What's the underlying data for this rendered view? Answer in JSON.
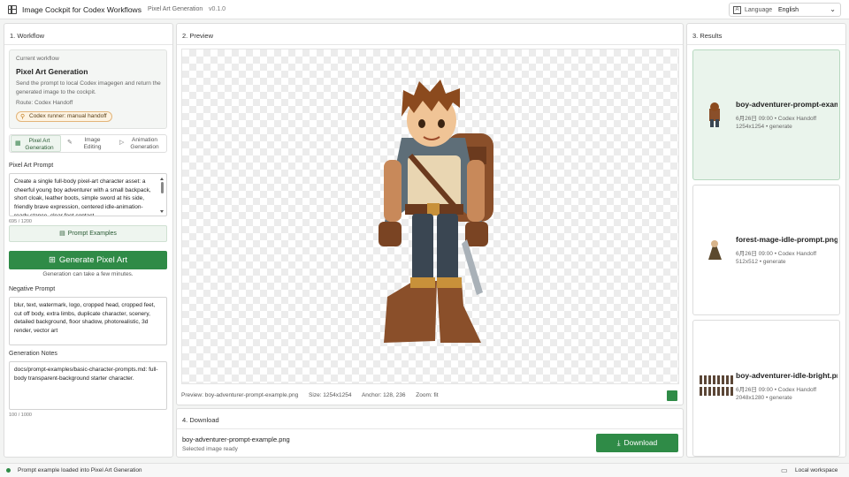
{
  "header": {
    "app_title": "Image Cockpit for Codex Workflows",
    "workflow_name": "Pixel Art Generation",
    "version": "v0.1.0",
    "language_label": "Language",
    "language_value": "English",
    "language_icon": "translate-icon"
  },
  "workflow": {
    "panel_title": "1. Workflow",
    "current_label": "Current workflow",
    "name": "Pixel Art Generation",
    "description": "Send the prompt to local Codex imagegen and return the generated image to the cockpit.",
    "route": "Route: Codex Handoff",
    "badge": "Codex runner: manual handoff",
    "tabs": [
      {
        "label_line1": "Pixel Art",
        "label_line2": "Generation",
        "active": true,
        "icon": "pixel-art-icon"
      },
      {
        "label_line1": "Image",
        "label_line2": "Editing",
        "active": false,
        "icon": "pencil-icon"
      },
      {
        "label_line1": "Animation",
        "label_line2": "Generation",
        "active": false,
        "icon": "animation-icon"
      }
    ],
    "prompt_label": "Pixel Art Prompt",
    "prompt_text": "Create a single full-body pixel-art character asset: a cheerful young boy adventurer with a small backpack, short cloak, leather boots, simple sword at his side, friendly brave expression, centered idle-animation-ready stance, clear feet contact",
    "prompt_counter": "695 / 1200",
    "examples_button": "Prompt Examples",
    "generate_button": "Generate Pixel Art",
    "generate_hint": "Generation can take a few minutes.",
    "negative_label": "Negative Prompt",
    "negative_text": "blur, text, watermark, logo, cropped head, cropped feet, cut off body, extra limbs, duplicate character, scenery, detailed background, floor shadow, photorealistic, 3d render, vector art",
    "notes_label": "Generation Notes",
    "notes_text": "docs/prompt-examples/basic-character-prompts.md: full-body transparent-background starter character.",
    "notes_counter": "100 / 1000"
  },
  "preview": {
    "panel_title": "2. Preview",
    "meta_preview": "Preview: boy-adventurer-prompt-example.png",
    "meta_size": "Size: 1254x1254",
    "meta_anchor": "Anchor: 128, 236",
    "meta_zoom": "Zoom: fit",
    "swatch_color": "#2f8b47"
  },
  "download": {
    "panel_title": "4. Download",
    "filename": "boy-adventurer-prompt-example.png",
    "status": "Selected image ready",
    "button": "Download"
  },
  "results": {
    "panel_title": "3. Results",
    "items": [
      {
        "name": "boy-adventurer-prompt-example.png",
        "line1": "6月26日 09:00 • Codex Handoff",
        "line2": "1254x1254 • generate",
        "selected": true
      },
      {
        "name": "forest-mage-idle-prompt.png",
        "line1": "6月26日 09:00 • Codex Handoff",
        "line2": "512x512 • generate",
        "selected": false
      },
      {
        "name": "boy-adventurer-idle-bright.png",
        "line1": "6月26日 09:00 • Codex Handoff",
        "line2": "2048x1280 • generate",
        "selected": false
      }
    ]
  },
  "status": {
    "text": "Prompt example loaded into Pixel Art Generation",
    "workspace": "Local workspace"
  },
  "colors": {
    "accent": "#2f8b47",
    "selected_card": "#eaf4ec",
    "badge_border": "#e3b57a"
  }
}
